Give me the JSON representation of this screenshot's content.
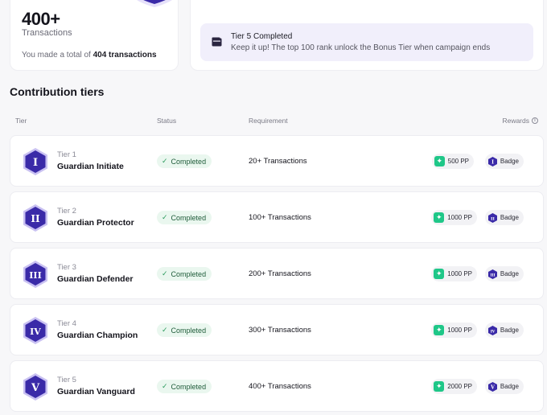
{
  "summary": {
    "count": "400+",
    "count_label": "Transactions",
    "total_prefix": "You made a total of",
    "total_value": "404 transactions"
  },
  "notice": {
    "title": "Tier 5 Completed",
    "subtitle": "Keep it up! The top 100 rank unlock the Bonus Tier when campaign ends",
    "icon": "wallet-icon"
  },
  "section": {
    "title": "Contribution tiers"
  },
  "columns": {
    "tier": "Tier",
    "status": "Status",
    "requirement": "Requirement",
    "rewards": "Rewards"
  },
  "tiers": [
    {
      "label": "Tier 1",
      "name": "Guardian Initiate",
      "numeral": "I",
      "status": "Completed",
      "requirement": "20+ Transactions",
      "points": "500 PP",
      "badge": "Badge"
    },
    {
      "label": "Tier 2",
      "name": "Guardian Protector",
      "numeral": "II",
      "status": "Completed",
      "requirement": "100+ Transactions",
      "points": "1000 PP",
      "badge": "Badge"
    },
    {
      "label": "Tier 3",
      "name": "Guardian Defender",
      "numeral": "III",
      "status": "Completed",
      "requirement": "200+ Transactions",
      "points": "1000 PP",
      "badge": "Badge"
    },
    {
      "label": "Tier 4",
      "name": "Guardian Champion",
      "numeral": "IV",
      "status": "Completed",
      "requirement": "300+ Transactions",
      "points": "1000 PP",
      "badge": "Badge"
    },
    {
      "label": "Tier 5",
      "name": "Guardian Vanguard",
      "numeral": "V",
      "status": "Completed",
      "requirement": "400+ Transactions",
      "points": "2000 PP",
      "badge": "Badge"
    }
  ],
  "colors": {
    "badge_purple": "#3a2aa8",
    "badge_border": "#c9c1f2",
    "status_bg": "#eaf7ef",
    "status_check": "#2a9a5c",
    "points_green": "#1fc788",
    "notice_bg": "#f1effb"
  }
}
